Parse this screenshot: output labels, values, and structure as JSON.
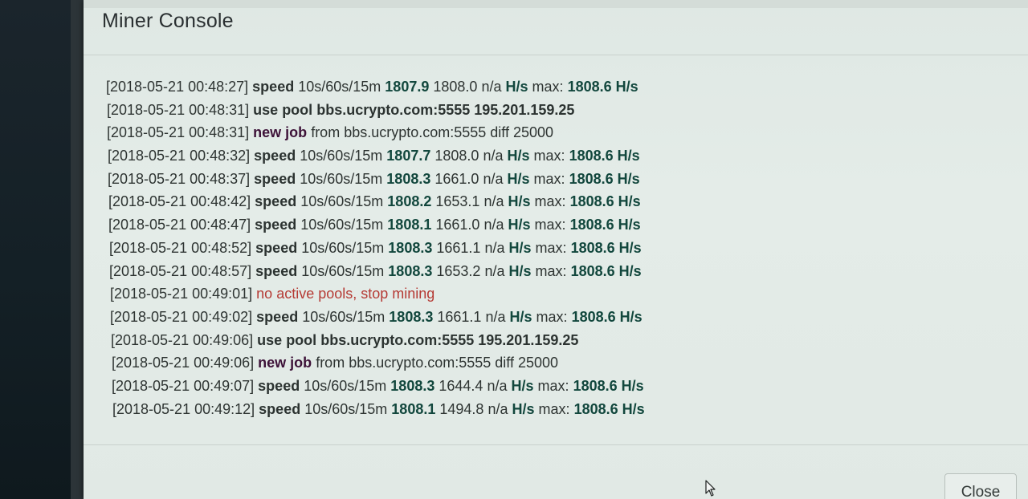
{
  "modal": {
    "title": "Miner Console",
    "close_label": "Close"
  },
  "colors": {
    "number": "#12473d",
    "job": "#3d1238",
    "error": "#b53a34"
  },
  "log": [
    {
      "ts": "[2018-05-21 00:48:27]",
      "type": "speed",
      "label": "speed",
      "window": "10s/60s/15m",
      "v10s": "1807.9",
      "v60s": "1808.0",
      "v15m": "n/a",
      "unit": "H/s",
      "max_label": "max:",
      "max": "1808.6 H/s"
    },
    {
      "ts": "[2018-05-21 00:48:31]",
      "type": "pool",
      "label": "use pool",
      "pool": "bbs.ucrypto.com:5555 195.201.159.25"
    },
    {
      "ts": "[2018-05-21 00:48:31]",
      "type": "job",
      "label": "new job",
      "rest": "from bbs.ucrypto.com:5555 diff 25000"
    },
    {
      "ts": "[2018-05-21 00:48:32]",
      "type": "speed",
      "label": "speed",
      "window": "10s/60s/15m",
      "v10s": "1807.7",
      "v60s": "1808.0",
      "v15m": "n/a",
      "unit": "H/s",
      "max_label": "max:",
      "max": "1808.6 H/s"
    },
    {
      "ts": "[2018-05-21 00:48:37]",
      "type": "speed",
      "label": "speed",
      "window": "10s/60s/15m",
      "v10s": "1808.3",
      "v60s": "1661.0",
      "v15m": "n/a",
      "unit": "H/s",
      "max_label": "max:",
      "max": "1808.6 H/s"
    },
    {
      "ts": "[2018-05-21 00:48:42]",
      "type": "speed",
      "label": "speed",
      "window": "10s/60s/15m",
      "v10s": "1808.2",
      "v60s": "1653.1",
      "v15m": "n/a",
      "unit": "H/s",
      "max_label": "max:",
      "max": "1808.6 H/s"
    },
    {
      "ts": "[2018-05-21 00:48:47]",
      "type": "speed",
      "label": "speed",
      "window": "10s/60s/15m",
      "v10s": "1808.1",
      "v60s": "1661.0",
      "v15m": "n/a",
      "unit": "H/s",
      "max_label": "max:",
      "max": "1808.6 H/s"
    },
    {
      "ts": "[2018-05-21 00:48:52]",
      "type": "speed",
      "label": "speed",
      "window": "10s/60s/15m",
      "v10s": "1808.3",
      "v60s": "1661.1",
      "v15m": "n/a",
      "unit": "H/s",
      "max_label": "max:",
      "max": "1808.6 H/s"
    },
    {
      "ts": "[2018-05-21 00:48:57]",
      "type": "speed",
      "label": "speed",
      "window": "10s/60s/15m",
      "v10s": "1808.3",
      "v60s": "1653.2",
      "v15m": "n/a",
      "unit": "H/s",
      "max_label": "max:",
      "max": "1808.6 H/s"
    },
    {
      "ts": "[2018-05-21 00:49:01]",
      "type": "error",
      "message": "no active pools, stop mining"
    },
    {
      "ts": "[2018-05-21 00:49:02]",
      "type": "speed",
      "label": "speed",
      "window": "10s/60s/15m",
      "v10s": "1808.3",
      "v60s": "1661.1",
      "v15m": "n/a",
      "unit": "H/s",
      "max_label": "max:",
      "max": "1808.6 H/s"
    },
    {
      "ts": "[2018-05-21 00:49:06]",
      "type": "pool",
      "label": "use pool",
      "pool": "bbs.ucrypto.com:5555 195.201.159.25"
    },
    {
      "ts": "[2018-05-21 00:49:06]",
      "type": "job",
      "label": "new job",
      "rest": "from bbs.ucrypto.com:5555 diff 25000"
    },
    {
      "ts": "[2018-05-21 00:49:07]",
      "type": "speed",
      "label": "speed",
      "window": "10s/60s/15m",
      "v10s": "1808.3",
      "v60s": "1644.4",
      "v15m": "n/a",
      "unit": "H/s",
      "max_label": "max:",
      "max": "1808.6 H/s"
    },
    {
      "ts": "[2018-05-21 00:49:12]",
      "type": "speed",
      "label": "speed",
      "window": "10s/60s/15m",
      "v10s": "1808.1",
      "v60s": "1494.8",
      "v15m": "n/a",
      "unit": "H/s",
      "max_label": "max:",
      "max": "1808.6 H/s"
    }
  ]
}
